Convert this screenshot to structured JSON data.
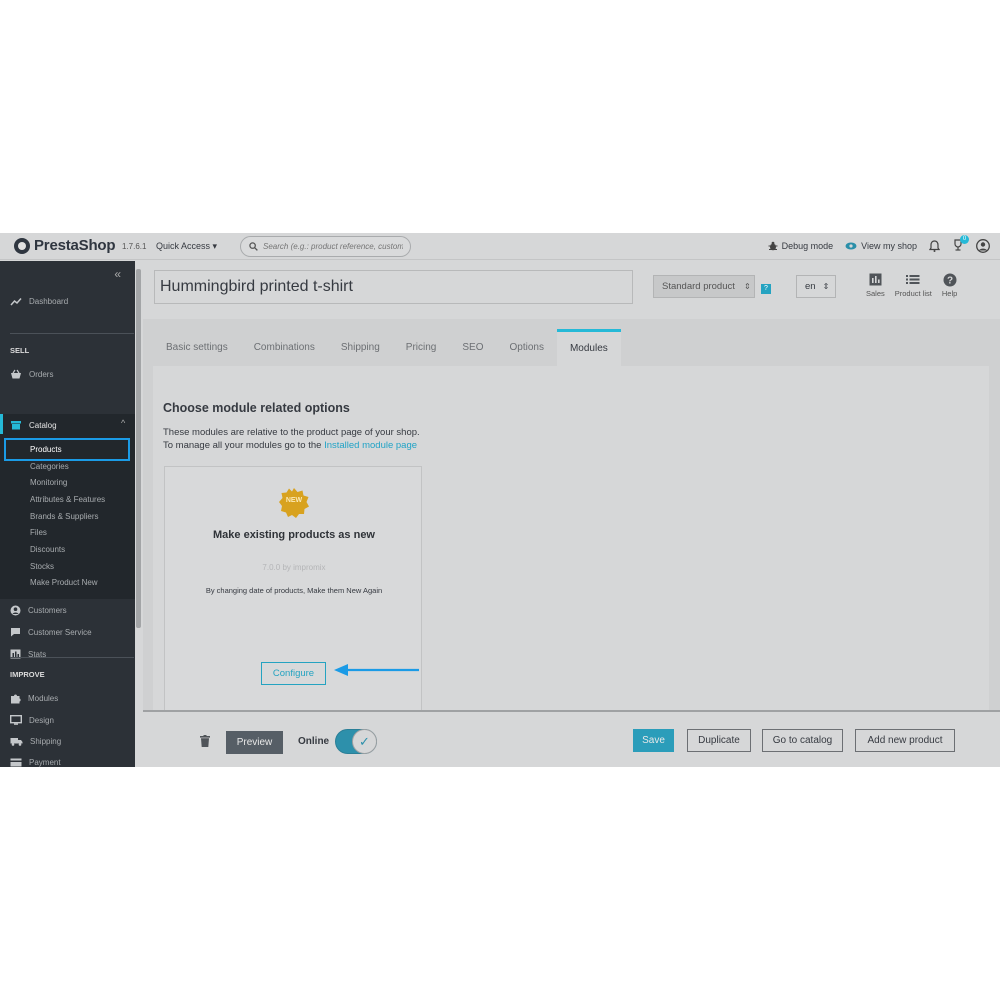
{
  "header": {
    "logo": "PrestaShop",
    "version": "1.7.6.1",
    "quick_access": "Quick Access",
    "search_placeholder": "Search (e.g.: product reference, customer name...)",
    "debug_mode": "Debug mode",
    "view_my_shop": "View my shop",
    "notifications_count": "0"
  },
  "sidebar": {
    "dashboard": "Dashboard",
    "sell_section": "SELL",
    "orders": "Orders",
    "catalog": "Catalog",
    "catalog_items": [
      "Products",
      "Categories",
      "Monitoring",
      "Attributes & Features",
      "Brands & Suppliers",
      "Files",
      "Discounts",
      "Stocks",
      "Make Product New"
    ],
    "customers": "Customers",
    "customer_service": "Customer Service",
    "stats": "Stats",
    "improve_section": "IMPROVE",
    "modules": "Modules",
    "design": "Design",
    "shipping": "Shipping",
    "payment": "Payment"
  },
  "product": {
    "name": "Hummingbird printed t-shirt",
    "type": "Standard product",
    "language": "en"
  },
  "toolbar": {
    "sales": "Sales",
    "product_list": "Product list",
    "help": "Help"
  },
  "tabs": [
    "Basic settings",
    "Combinations",
    "Shipping",
    "Pricing",
    "SEO",
    "Options",
    "Modules"
  ],
  "active_tab": "Modules",
  "modules_panel": {
    "heading": "Choose module related options",
    "line1": "These modules are relative to the product page of your shop.",
    "line2_prefix": "To manage all your modules go to the ",
    "line2_link": "Installed module page"
  },
  "module_card": {
    "badge": "NEW",
    "title": "Make existing products as new",
    "version": "7.0.0 by impromix",
    "description": "By changing date of products, Make them New Again",
    "configure": "Configure"
  },
  "footer": {
    "preview": "Preview",
    "online": "Online",
    "online_state": true,
    "save": "Save",
    "duplicate": "Duplicate",
    "go_to_catalog": "Go to catalog",
    "add_new_product": "Add new product"
  },
  "colors": {
    "accent": "#25b9d7",
    "highlight_box": "#1b9be6",
    "sidebar_bg": "#2c3137",
    "seal": "#d8a21f"
  }
}
